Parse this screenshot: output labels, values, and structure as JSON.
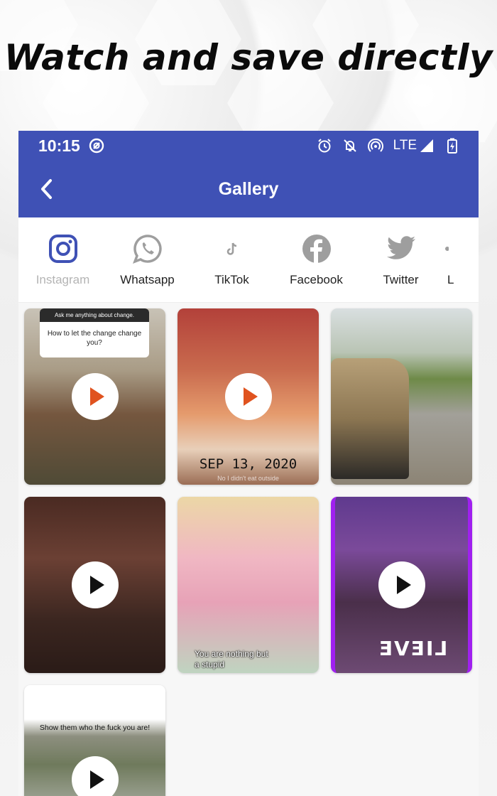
{
  "headline": "Watch and save directly",
  "status_bar": {
    "time": "10:15",
    "network": "LTE"
  },
  "app_bar": {
    "title": "Gallery"
  },
  "tabs": [
    {
      "label": "Instagram",
      "icon": "instagram-icon",
      "active": true
    },
    {
      "label": "Whatsapp",
      "icon": "whatsapp-icon",
      "active": false
    },
    {
      "label": "TikTok",
      "icon": "tiktok-icon",
      "active": false
    },
    {
      "label": "Facebook",
      "icon": "facebook-icon",
      "active": false
    },
    {
      "label": "Twitter",
      "icon": "twitter-icon",
      "active": false
    },
    {
      "label": "L",
      "icon": "more-icon",
      "active": false
    }
  ],
  "gallery": {
    "items": [
      {
        "type": "video",
        "question_header": "Ask me anything about change.",
        "question_text": "How to let the change change you?"
      },
      {
        "type": "video",
        "overlay_text": "SEP 13, 2020",
        "overlay_subtext": "No I didn't eat outside"
      },
      {
        "type": "image"
      },
      {
        "type": "video"
      },
      {
        "type": "image",
        "caption_line1": "You are nothing but",
        "caption_line2": "a stupid"
      },
      {
        "type": "video",
        "shirt_text": "LIEVE"
      },
      {
        "type": "video",
        "caption": "Show them who the fuck you are!"
      }
    ]
  },
  "colors": {
    "primary": "#3f51b5",
    "tab_inactive_label": "#222222",
    "tab_active_label": "#b4b4b4",
    "instagram_icon": "#3f51b5",
    "social_icon_gray": "#9e9e9e"
  }
}
